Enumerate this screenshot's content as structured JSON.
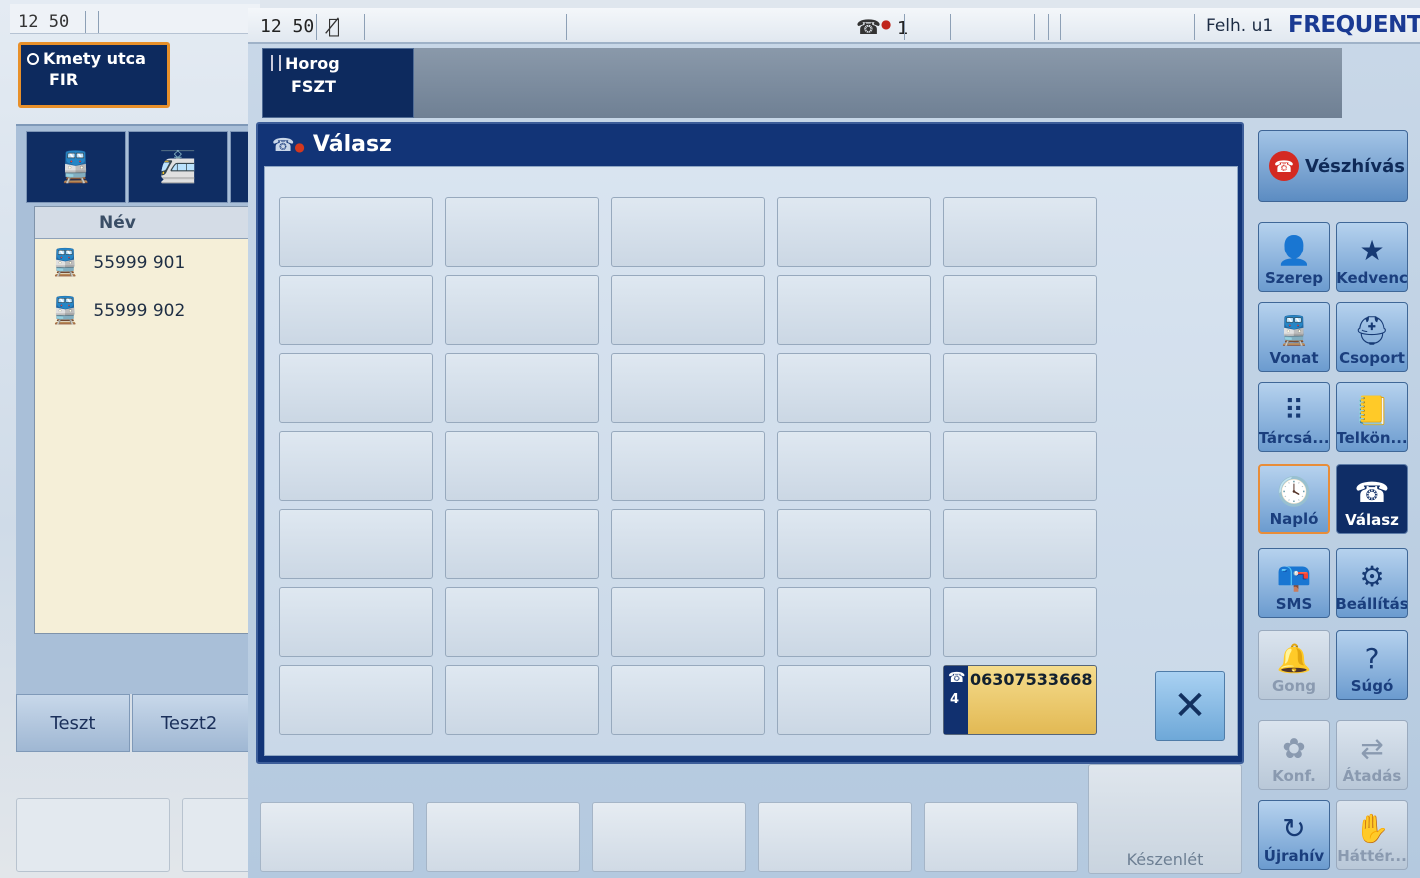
{
  "background_screen": {
    "status": {
      "time": "12 50"
    },
    "position": {
      "name": "Kmety utca",
      "sub": "FIR"
    },
    "list": {
      "header": "Név",
      "rows": [
        {
          "icon": "train-icon",
          "name": "55999 901"
        },
        {
          "icon": "train-icon",
          "name": "55999 902"
        }
      ]
    },
    "tabs": [
      {
        "label": "Teszt"
      },
      {
        "label": "Teszt2"
      }
    ]
  },
  "status": {
    "time": "12 50",
    "active_calls": "1",
    "user": "Felh. u1",
    "brand": "FREQUENTIS"
  },
  "position": {
    "name": "Horog",
    "sub": "FSZT"
  },
  "dialog": {
    "title": "Válasz",
    "active_call": {
      "number": "06307533668",
      "index": "4"
    }
  },
  "rail": {
    "emergency": "Vészhívás",
    "buttons": {
      "szerep": "Szerep",
      "kedvenc": "Kedvenc",
      "vonat": "Vonat",
      "csoport": "Csoport",
      "tarcsa": "Tárcsá...",
      "telkon": "Telkön...",
      "naplo": "Napló",
      "valasz": "Válasz",
      "sms": "SMS",
      "beallitas": "Beállítás",
      "gong": "Gong",
      "sugo": "Súgó",
      "konf": "Konf.",
      "atadas": "Átadás",
      "ujrahiv": "Újrahív",
      "hatter": "Háttér..."
    }
  },
  "bottom": {
    "standby": "Készenlét"
  },
  "colors": {
    "navy": "#0f2d63",
    "highlight_orange": "#e8902a",
    "active_call_gold": "#e2b954",
    "emergency_red": "#d42a22"
  }
}
